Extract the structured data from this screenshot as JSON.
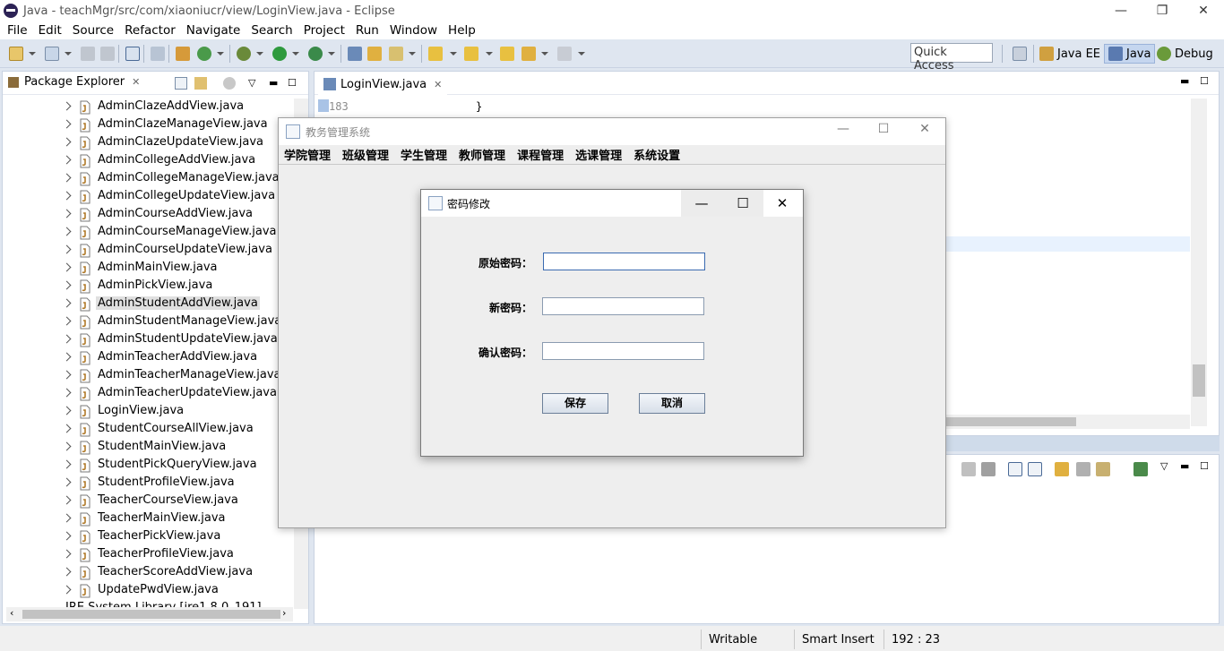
{
  "window": {
    "title": "Java - teachMgr/src/com/xiaoniucr/view/LoginView.java - Eclipse",
    "controls": [
      "—",
      "❐",
      "✕"
    ]
  },
  "menu": [
    "File",
    "Edit",
    "Source",
    "Refactor",
    "Navigate",
    "Search",
    "Project",
    "Run",
    "Window",
    "Help"
  ],
  "toolbar": {
    "quick_access": "Quick Access",
    "perspectives": [
      {
        "label": "Java EE"
      },
      {
        "label": "Java",
        "active": true
      },
      {
        "label": "Debug"
      }
    ]
  },
  "package_explorer": {
    "tab_label": "Package Explorer",
    "close_glyph": "✕",
    "files": [
      "AdminClazeAddView.java",
      "AdminClazeManageView.java",
      "AdminClazeUpdateView.java",
      "AdminCollegeAddView.java",
      "AdminCollegeManageView.java",
      "AdminCollegeUpdateView.java",
      "AdminCourseAddView.java",
      "AdminCourseManageView.java",
      "AdminCourseUpdateView.java",
      "AdminMainView.java",
      "AdminPickView.java",
      "AdminStudentAddView.java",
      "AdminStudentManageView.java",
      "AdminStudentUpdateView.java",
      "AdminTeacherAddView.java",
      "AdminTeacherManageView.java",
      "AdminTeacherUpdateView.java",
      "LoginView.java",
      "StudentCourseAllView.java",
      "StudentMainView.java",
      "StudentPickQueryView.java",
      "StudentProfileView.java",
      "TeacherCourseView.java",
      "TeacherMainView.java",
      "TeacherPickView.java",
      "TeacherProfileView.java",
      "TeacherScoreAddView.java",
      "UpdatePwdView.java"
    ],
    "selected_index": 11,
    "partial_row": "JRE System Library [jre1.8.0_191]"
  },
  "editor": {
    "tab_label": "LoginView.java",
    "close_glyph": "✕",
    "line_number": "183",
    "code_line": "}"
  },
  "status_bar": {
    "mode": "Writable",
    "insert": "Smart Insert",
    "position": "192 : 23"
  },
  "swing_app": {
    "title": "教务管理系统",
    "controls": [
      "—",
      "☐",
      "✕"
    ],
    "menu": [
      "学院管理",
      "班级管理",
      "学生管理",
      "教师管理",
      "课程管理",
      "选课管理",
      "系统设置"
    ]
  },
  "dialog": {
    "title": "密码修改",
    "controls": [
      "—",
      "☐",
      "✕"
    ],
    "fields": [
      {
        "label": "原始密码：",
        "value": ""
      },
      {
        "label": "新密码：",
        "value": ""
      },
      {
        "label": "确认密码：",
        "value": ""
      }
    ],
    "save_label": "保存",
    "cancel_label": "取消"
  }
}
